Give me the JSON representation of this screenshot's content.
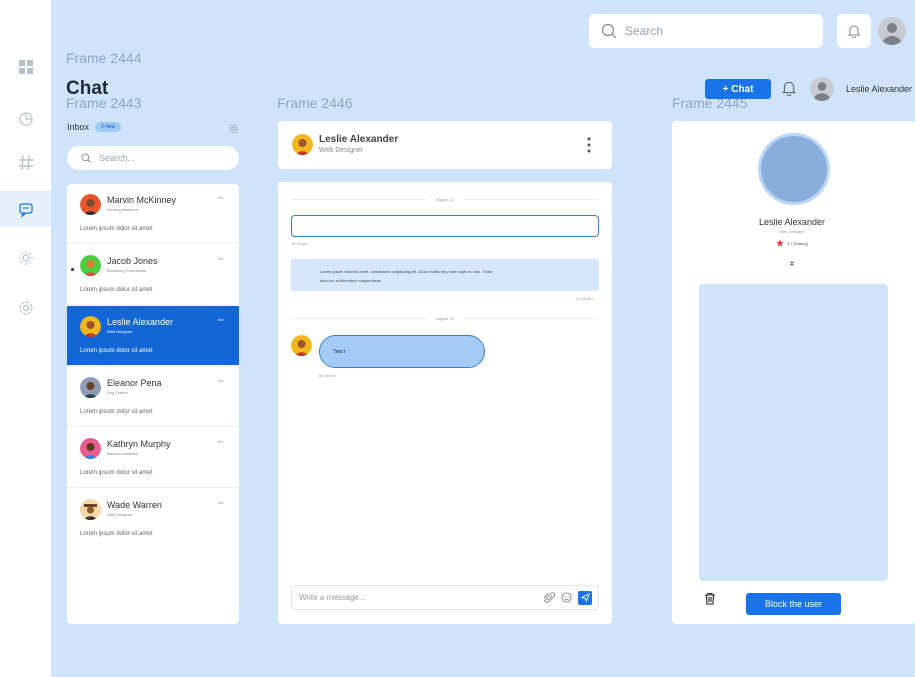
{
  "frames": {
    "f2444": "Frame 2444",
    "f2443": "Frame 2443",
    "f2446": "Frame 2446",
    "f2445": "Frame 2445"
  },
  "topbar": {
    "search_placeholder": "Search"
  },
  "header": {
    "title": "Chat",
    "new_chat_label": "+ Chat",
    "user_name": "Leslie Alexander"
  },
  "inbox": {
    "label": "Inbox",
    "badge": "2 New",
    "search_placeholder": "Search..."
  },
  "contacts": [
    {
      "name": "Marvin McKinney",
      "role": "Nursing Assistant",
      "time": "5m",
      "preview": "Lorem ipsum dolor sit amet",
      "avatar_color": "#e8552e",
      "unread": false,
      "selected": false
    },
    {
      "name": "Jacob Jones",
      "role": "Marketing Coordinator",
      "time": "5m",
      "preview": "Lorem ipsum dolor sit amet",
      "avatar_color": "#4ccf3f",
      "unread": true,
      "selected": false
    },
    {
      "name": "Leslie Alexander",
      "role": "Web Designer",
      "time": "5m",
      "preview": "Lorem ipsum dolor sit amet",
      "avatar_color": "#f2b61f",
      "unread": false,
      "selected": true
    },
    {
      "name": "Eleanor Pena",
      "role": "Dog Trainer",
      "time": "5m",
      "preview": "Lorem ipsum dolor sit amet",
      "avatar_color": "#8e9bb5",
      "unread": false,
      "selected": false
    },
    {
      "name": "Kathryn Murphy",
      "role": "Medical Assistant",
      "time": "5m",
      "preview": "Lorem ipsum dolor sit amet",
      "avatar_color": "#e85d8e",
      "unread": false,
      "selected": false
    },
    {
      "name": "Wade Warren",
      "role": "Web Designer",
      "time": "5m",
      "preview": "Lorem ipsum dolor sit amet",
      "avatar_color": "#f6d7a6",
      "unread": false,
      "selected": false
    }
  ],
  "conversation": {
    "name": "Leslie Alexander",
    "role": "Web Designer",
    "date1": "August 21",
    "time1": "10:15 pm",
    "message_line1": "Lorem ipsum dolor sit amet, consectetur adipiscing elit. Dolor mattis leo proin turpis eu hac. Tortor",
    "message_line2": "dolor eu at bibendum suspendisse.",
    "time2": "12:15 pm",
    "date2": "August 22",
    "bubble_text": "Текст",
    "time3": "06:00 pm",
    "composer_placeholder": "Write a message..."
  },
  "profile": {
    "name": "Leslie Alexander",
    "role": "Web Designer",
    "rating": "4.7 (Rating)",
    "hash": "#",
    "block_label": "Block the user"
  },
  "colors": {
    "accent": "#1a73e8",
    "selected_row": "#1366d6",
    "background": "#cfe3fb"
  }
}
